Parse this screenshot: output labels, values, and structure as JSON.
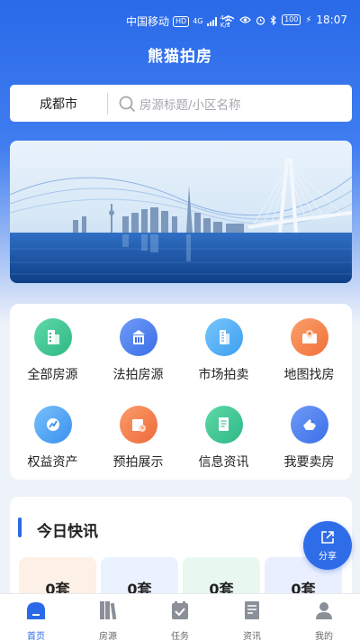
{
  "status_bar": {
    "carrier": "中国移动",
    "hd_badge": "HD",
    "network_type": "4G",
    "net_speed_value": "4.6",
    "net_speed_unit": "K/s",
    "battery": "100",
    "time": "18:07"
  },
  "header": {
    "title": "熊猫拍房"
  },
  "search": {
    "city": "成都市",
    "placeholder": "房源标题/小区名称"
  },
  "menu": {
    "items": [
      {
        "label": "全部房源",
        "icon": "building-icon",
        "color": "#34c38f"
      },
      {
        "label": "法拍房源",
        "icon": "bank-icon",
        "color": "#4a7df0"
      },
      {
        "label": "市场拍卖",
        "icon": "office-tower-icon",
        "color": "#4aa8f0"
      },
      {
        "label": "地图找房",
        "icon": "map-pin-icon",
        "color": "#f07c3c"
      },
      {
        "label": "权益资产",
        "icon": "growth-icon",
        "color": "#3a9af0"
      },
      {
        "label": "预拍展示",
        "icon": "calendar-clock-icon",
        "color": "#f07c3c"
      },
      {
        "label": "信息资讯",
        "icon": "document-icon",
        "color": "#34c38f"
      },
      {
        "label": "我要卖房",
        "icon": "house-tag-icon",
        "color": "#4a7df0"
      }
    ]
  },
  "news": {
    "title": "今日快讯",
    "stats": [
      {
        "value": "0套",
        "bg": "#fdf0e6"
      },
      {
        "value": "0套",
        "bg": "#eaf2ff"
      },
      {
        "value": "0套",
        "bg": "#e8f8f0"
      },
      {
        "value": "0套",
        "bg": "#eaefff"
      }
    ]
  },
  "share": {
    "label": "分享"
  },
  "tabs": [
    {
      "label": "首页",
      "icon": "home-icon",
      "active": true
    },
    {
      "label": "房源",
      "icon": "books-icon",
      "active": false
    },
    {
      "label": "任务",
      "icon": "task-check-icon",
      "active": false
    },
    {
      "label": "资讯",
      "icon": "news-icon",
      "active": false
    },
    {
      "label": "我的",
      "icon": "user-icon",
      "active": false
    }
  ],
  "colors": {
    "primary": "#2a6ae8",
    "tab_inactive": "#666666"
  }
}
